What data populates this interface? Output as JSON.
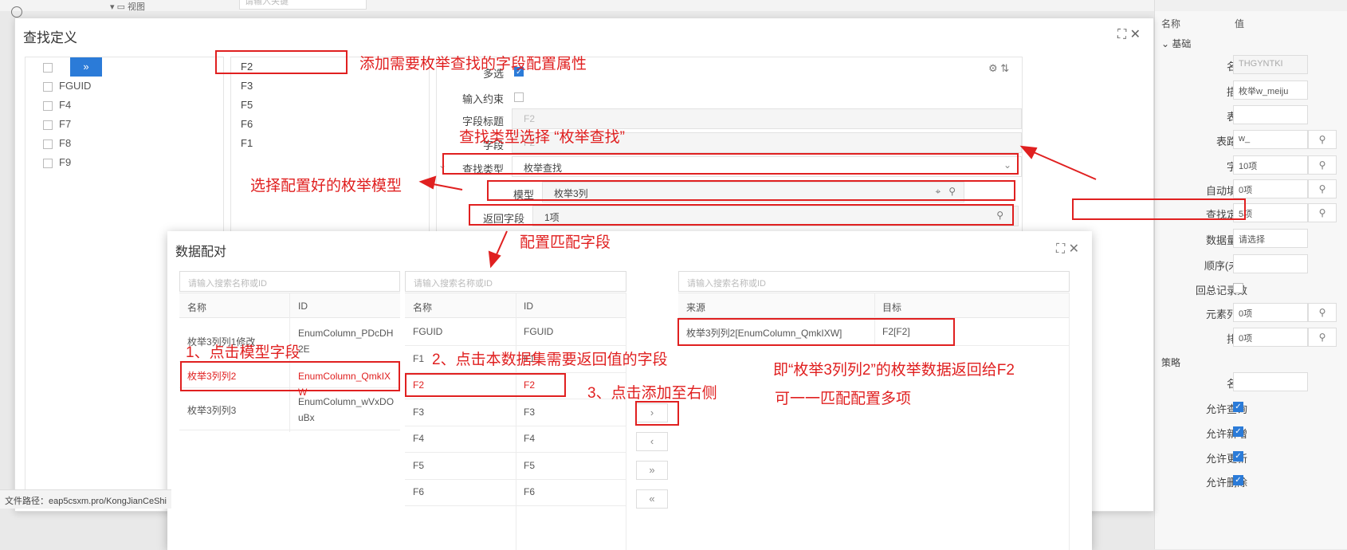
{
  "background": {
    "tree_item": "视图",
    "search_placeholder": "请输入关键"
  },
  "property_panel": {
    "header": {
      "name": "名称",
      "value": "值"
    },
    "sections": {
      "basic": "基础",
      "strategy": "策略"
    },
    "rows": [
      {
        "label": "名称",
        "value": "THGYNTKI",
        "disabled": true
      },
      {
        "label": "描述",
        "value": "枚举w_meiju"
      },
      {
        "label": "表名",
        "value": ""
      },
      {
        "label": "表路径",
        "value": "w_"
      },
      {
        "label": "字段",
        "value": "10项"
      },
      {
        "label": "自动填充",
        "value": "0项"
      },
      {
        "label": "查找定义",
        "value": "5项"
      },
      {
        "label": "数据量级",
        "value": "请选择"
      },
      {
        "label": "顺序(未...",
        "value": ""
      },
      {
        "label": "回总记录数",
        "value": ""
      },
      {
        "label": "元素列表",
        "value": "0项"
      },
      {
        "label": "排序",
        "value": "0项"
      }
    ],
    "strategy_rows": [
      {
        "label": "名称",
        "value": ""
      },
      {
        "label": "允许查询",
        "checked": true
      },
      {
        "label": "允许新增",
        "checked": true
      },
      {
        "label": "允许更新",
        "checked": true
      },
      {
        "label": "允许删除",
        "checked": true
      }
    ]
  },
  "find_dialog": {
    "title": "查找定义",
    "move_button": "»",
    "left_fields": [
      "FGUID",
      "F4",
      "F7",
      "F8",
      "F9"
    ],
    "mid_fields": [
      "F2",
      "F3",
      "F5",
      "F6",
      "F1"
    ],
    "form": {
      "multi_select": "多选",
      "input_constraint": "输入约束",
      "field_title_label": "字段标题",
      "field_title_value": "F2",
      "field_label": "字段",
      "field_value": "F2",
      "find_type_label": "查找类型",
      "find_type_value": "枚举查找",
      "model_label": "模型",
      "model_value": "枚举3列",
      "return_field_label": "返回字段",
      "return_field_value": "1项"
    }
  },
  "pair_dialog": {
    "title": "数据配对",
    "search_placeholder": "请输入搜索名称或ID",
    "left_table": {
      "headers": [
        "名称",
        "ID"
      ],
      "rows": [
        {
          "name": "枚举3列列1修改",
          "id": "EnumColumn_PDcDH2E"
        },
        {
          "name": "枚举3列列2",
          "id": "EnumColumn_QmkIXW"
        },
        {
          "name": "枚举3列列3",
          "id": "EnumColumn_wVxDOuBx"
        }
      ]
    },
    "mid_table": {
      "headers": [
        "名称",
        "ID"
      ],
      "rows": [
        {
          "name": "FGUID",
          "id": "FGUID"
        },
        {
          "name": "F1",
          "id": "F1"
        },
        {
          "name": "F2",
          "id": "F2"
        },
        {
          "name": "F3",
          "id": "F3"
        },
        {
          "name": "F4",
          "id": "F4"
        },
        {
          "name": "F5",
          "id": "F5"
        },
        {
          "name": "F6",
          "id": "F6"
        }
      ]
    },
    "buttons": [
      "›",
      "‹",
      "»",
      "«"
    ],
    "right_table": {
      "headers": [
        "来源",
        "目标"
      ],
      "rows": [
        {
          "source": "枚举3列列2[EnumColumn_QmkIXW]",
          "target": "F2[F2]"
        }
      ]
    }
  },
  "annotations": {
    "add_fields": "添加需要枚举查找的字段配置属性",
    "find_type": "查找类型选择 “枚举查找”",
    "select_model": "选择配置好的枚举模型",
    "config_match": "配置匹配字段",
    "step1": "1、点击模型字段",
    "step2": "2、点击本数据集需要返回值的字段",
    "step3": "3、点击添加至右侧",
    "result1": "即“枚举3列列2”的枚举数据返回给F2",
    "result2": "可一一匹配配置多项"
  },
  "status_bar": {
    "path": "文件路径：eap5csxm.pro/KongJianCeShi"
  },
  "colors": {
    "accent": "#2b7bd8",
    "annotation": "#e02020"
  }
}
